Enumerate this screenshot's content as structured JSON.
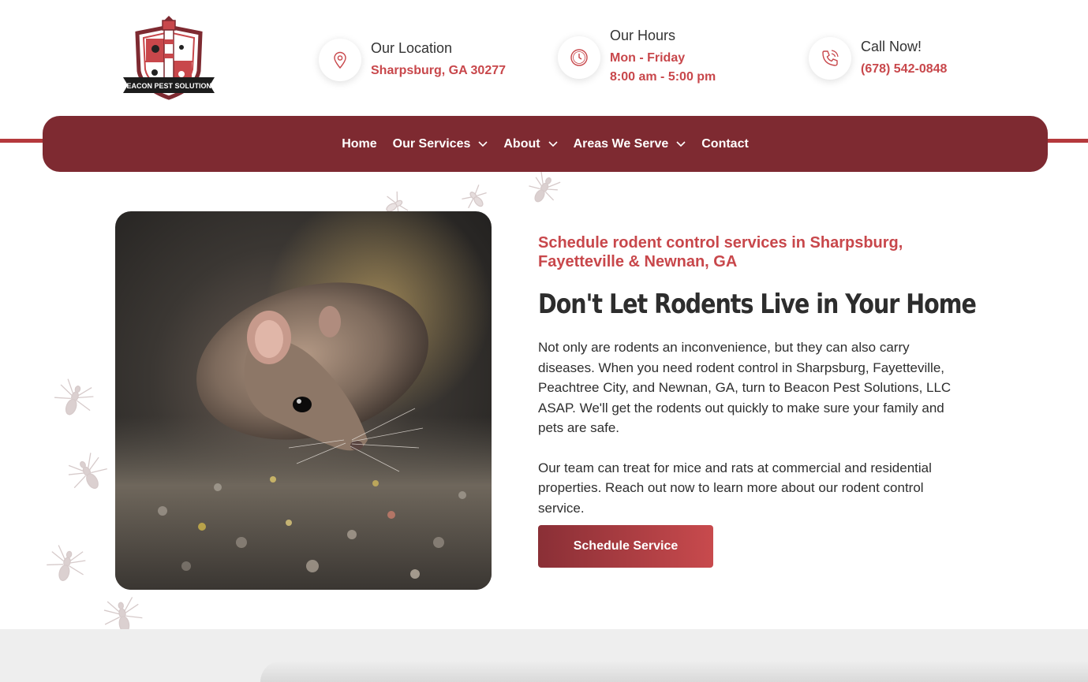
{
  "header": {
    "logo_text": "BEACON PEST SOLUTIONS",
    "location": {
      "label": "Our Location",
      "value": "Sharpsburg, GA 30277",
      "icon": "map-pin-icon"
    },
    "hours": {
      "label": "Our Hours",
      "days": "Mon - Friday",
      "time": "8:00 am - 5:00 pm",
      "icon": "clock-icon"
    },
    "call": {
      "label": "Call Now!",
      "value": "(678) 542-0848",
      "icon": "phone-icon"
    }
  },
  "nav": {
    "items": [
      {
        "label": "Home",
        "dropdown": false
      },
      {
        "label": "Our Services",
        "dropdown": true
      },
      {
        "label": "About",
        "dropdown": true
      },
      {
        "label": "Areas We Serve",
        "dropdown": true
      },
      {
        "label": "Contact",
        "dropdown": false
      }
    ]
  },
  "main": {
    "subheading": "Schedule rodent control services in Sharpsburg, Fayetteville & Newnan, GA",
    "heading": "Don't Let Rodents Live in Your Home",
    "paragraph_1": "Not only are rodents an inconvenience, but they can also carry diseases. When you need rodent control in Sharpsburg, Fayetteville, Peachtree City, and Newnan, GA, turn to Beacon Pest Solutions, LLC ASAP. We'll get the rodents out quickly to make sure your family and pets are safe.",
    "paragraph_2": "Our team can treat for mice and rats at commercial and residential properties. Reach out now to learn more about our rodent control service.",
    "cta_label": "Schedule Service"
  },
  "colors": {
    "accent": "#c8474b",
    "nav_bg": "#7e2a31",
    "nav_line": "#b5393c"
  }
}
